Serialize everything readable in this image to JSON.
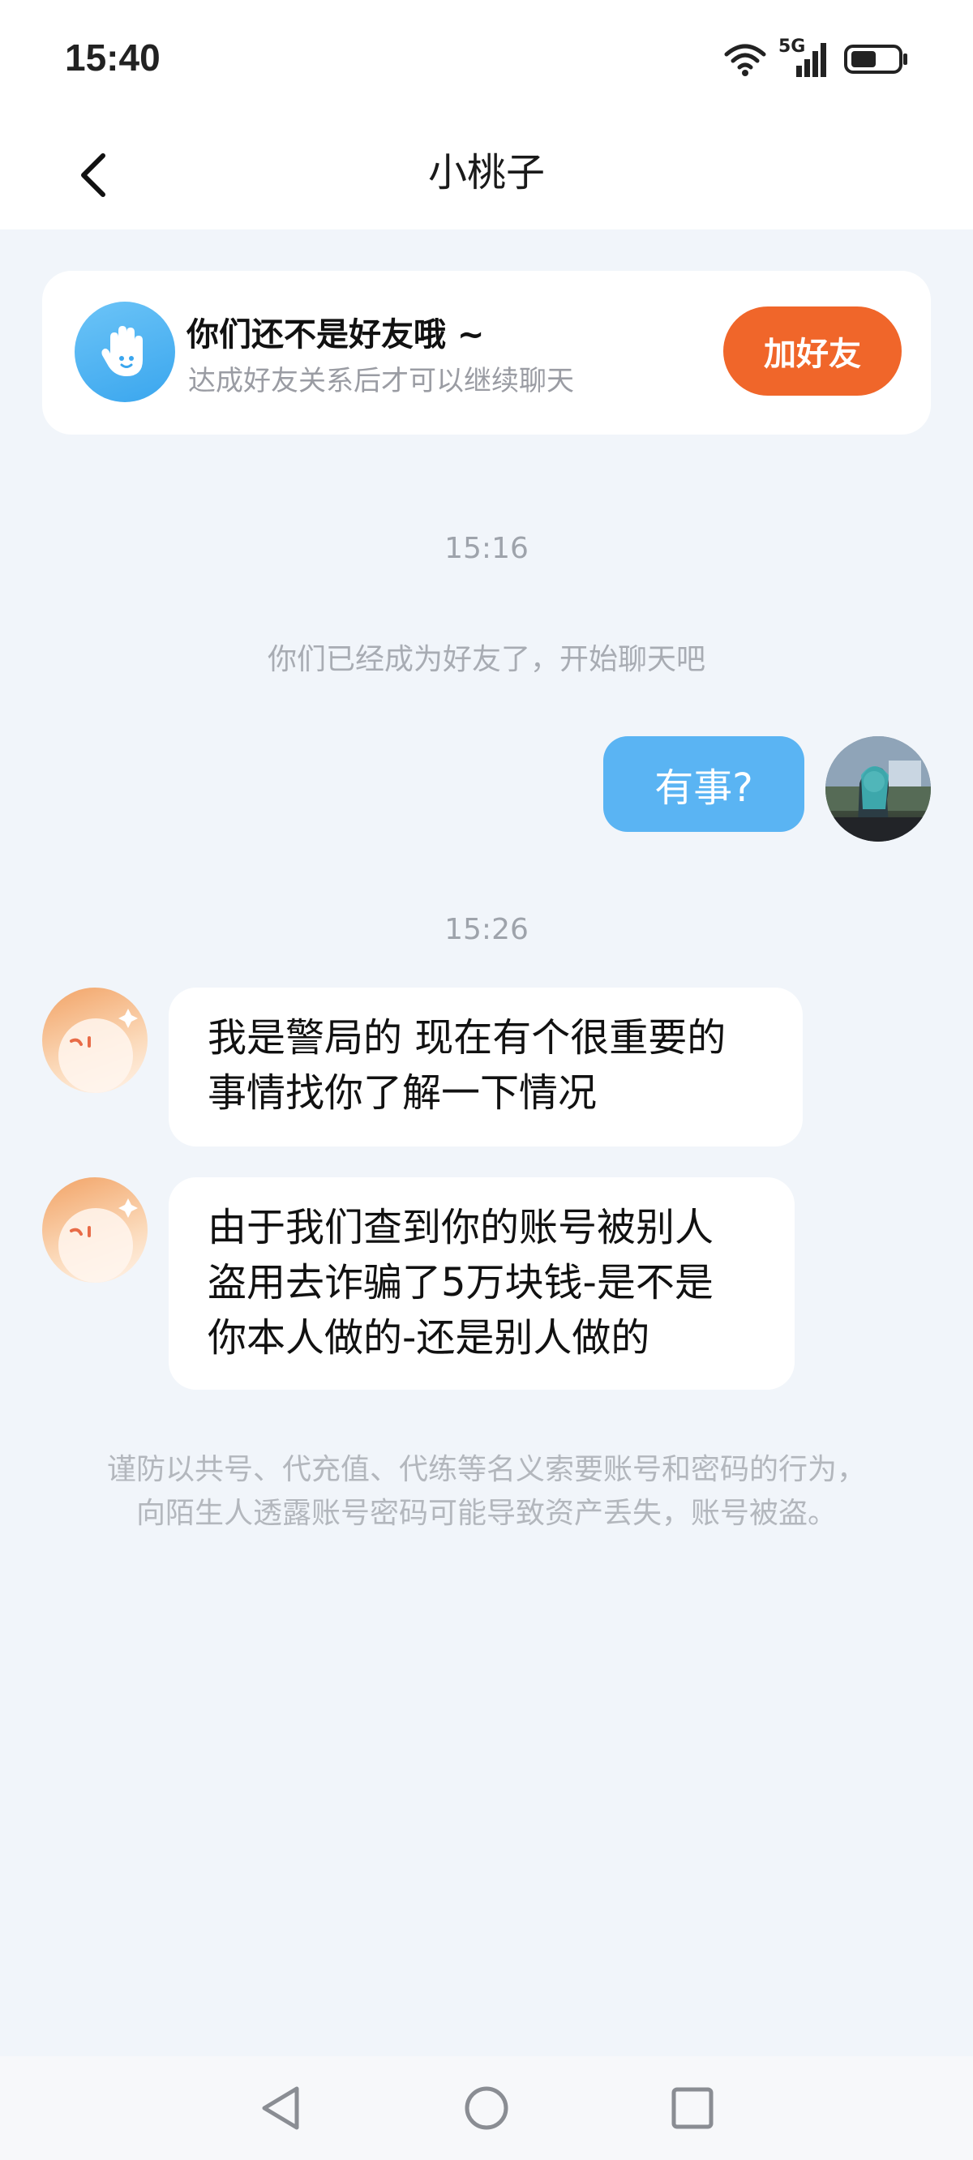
{
  "status_bar": {
    "time": "15:40",
    "network": "5G"
  },
  "header": {
    "title": "小桃子"
  },
  "friend_card": {
    "title": "你们还不是好友哦 ~",
    "subtitle": "达成好友关系后才可以继续聊天",
    "button_label": "加好友",
    "accent_color": "#f0662a"
  },
  "chat": {
    "timestamp_1": "15:16",
    "system_message": "你们已经成为好友了，开始聊天吧",
    "outgoing_message": "有事?",
    "timestamp_2": "15:26",
    "incoming_messages": [
      {
        "line1": "我是警局的 现在有个很重要的",
        "line2": "事情找你了解一下情况"
      },
      {
        "line1": "由于我们查到你的账号被别人",
        "line2": "盗用去诈骗了5万块钱-是不是",
        "line3": "你本人做的-还是别人做的"
      }
    ]
  },
  "safety_notice": "谨防以共号、代充值、代练等名义索要账号和密码的行为，向陌生人透露账号密码可能导致资产丢失，账号被盗。",
  "icons": [
    "wifi-icon",
    "signal-icon",
    "battery-icon",
    "back-arrow-icon",
    "waving-hand-icon",
    "nav-back-icon",
    "nav-home-icon",
    "nav-recents-icon"
  ]
}
